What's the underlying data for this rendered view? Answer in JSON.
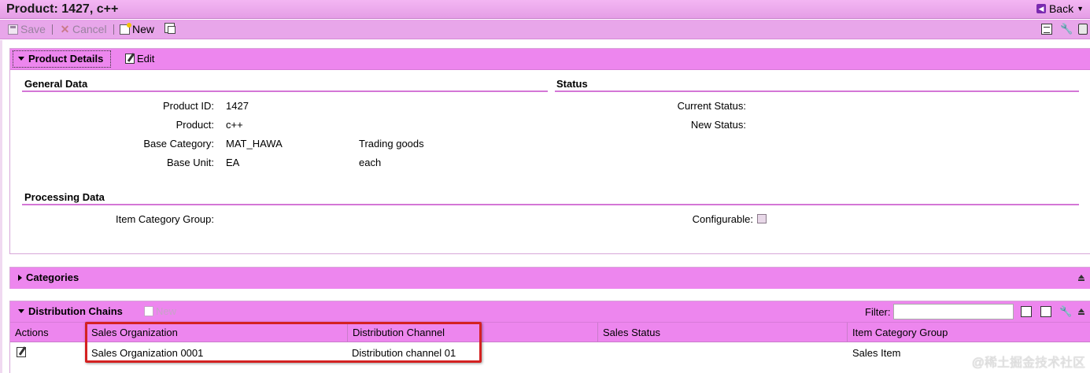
{
  "window": {
    "title": "Product: 1427, c++",
    "back_label": "Back"
  },
  "toolbar": {
    "save": "Save",
    "cancel": "Cancel",
    "new": "New"
  },
  "product_details": {
    "header": "Product Details",
    "edit": "Edit",
    "general_data": {
      "title": "General Data",
      "product_id_label": "Product ID:",
      "product_id": "1427",
      "product_label": "Product:",
      "product": "c++",
      "base_category_label": "Base Category:",
      "base_category": "MAT_HAWA",
      "base_category_desc": "Trading goods",
      "base_unit_label": "Base Unit:",
      "base_unit": "EA",
      "base_unit_desc": "each"
    },
    "status": {
      "title": "Status",
      "current_status_label": "Current Status:",
      "new_status_label": "New Status:"
    },
    "processing_data": {
      "title": "Processing Data",
      "item_category_group_label": "Item Category Group:",
      "configurable_label": "Configurable:",
      "configurable": false
    }
  },
  "categories": {
    "header": "Categories"
  },
  "distribution_chains": {
    "header": "Distribution Chains",
    "new": "New",
    "filter_label": "Filter:",
    "filter_value": "",
    "columns": [
      "Actions",
      "Sales Organization",
      "Distribution Channel",
      "Sales Status",
      "Item Category Group"
    ],
    "rows": [
      {
        "sales_org": "Sales Organization 0001",
        "dist_channel": "Distribution channel 01",
        "sales_status": "",
        "item_cat_group": "Sales Item"
      }
    ]
  },
  "watermark": "@稀土掘金技术社区",
  "colors": {
    "header_bg": "#ed86ee",
    "toolbar_bg": "#e8a6ea",
    "highlight": "#d42121"
  }
}
